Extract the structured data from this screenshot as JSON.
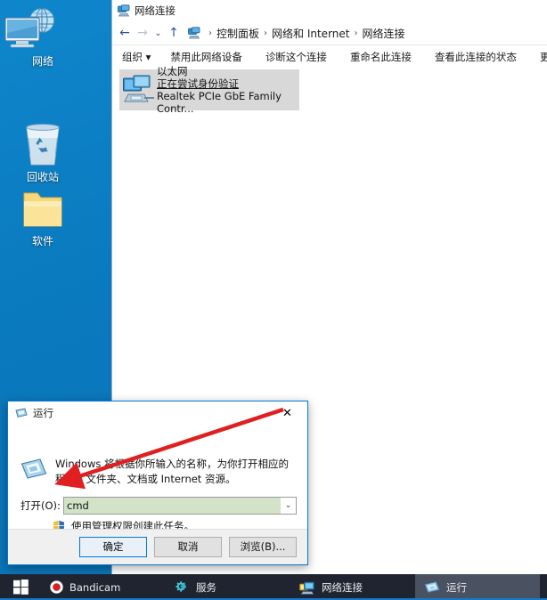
{
  "desktop": {
    "icons": [
      {
        "label": "网络",
        "icon": "network-globe-icon"
      },
      {
        "label": "回收站",
        "icon": "recycle-bin-icon"
      },
      {
        "label": "软件",
        "icon": "folder-icon"
      }
    ]
  },
  "explorer": {
    "title": "网络连接",
    "title_icon": "network-connections-icon",
    "nav": {
      "back": "←",
      "forward": "→",
      "history": "⌄",
      "up": "↑"
    },
    "breadcrumb": {
      "icon": "network-connections-icon",
      "items": [
        "控制面板",
        "网络和 Internet",
        "网络连接"
      ],
      "separator": "›"
    },
    "toolbar": [
      "组织 ▾",
      "禁用此网络设备",
      "诊断这个连接",
      "重命名此连接",
      "查看此连接的状态",
      "更改此连接的设置"
    ],
    "connection": {
      "icon": "ethernet-adapter-icon",
      "name": "以太网",
      "status": "正在尝试身份验证",
      "adapter": "Realtek PCIe GbE Family Contr..."
    }
  },
  "run_dialog": {
    "title": "运行",
    "title_icon": "run-icon",
    "close_label": "✕",
    "description": "Windows 将根据你所输入的名称，为你打开相应的程序、文件夹、文档或 Internet 资源。",
    "open_label": "打开(O):",
    "open_value": "cmd",
    "open_placeholder": "",
    "dropdown_caret": "⌄",
    "admin_note": "使用管理权限创建此任务。",
    "admin_icon": "uac-shield-icon",
    "buttons": {
      "ok": "确定",
      "cancel": "取消",
      "browse": "浏览(B)..."
    }
  },
  "annotation": {
    "type": "red-arrow",
    "color": "#e02020",
    "points_to": "open_value_field"
  },
  "taskbar": {
    "start_icon": "windows-start-icon",
    "items": [
      {
        "label": "Bandicam",
        "icon": "bandicam-record-icon",
        "active": false
      },
      {
        "label": "服务",
        "icon": "services-gears-icon",
        "active": false
      },
      {
        "label": "网络连接",
        "icon": "network-connections-icon",
        "active": false
      },
      {
        "label": "运行",
        "icon": "run-icon",
        "active": true
      }
    ]
  },
  "colors": {
    "desktop_blue": "#0a79bd",
    "accent_blue": "#0078d7",
    "input_green": "#d3e3c7",
    "taskbar": "#1f2430",
    "annotation_red": "#e02020"
  }
}
